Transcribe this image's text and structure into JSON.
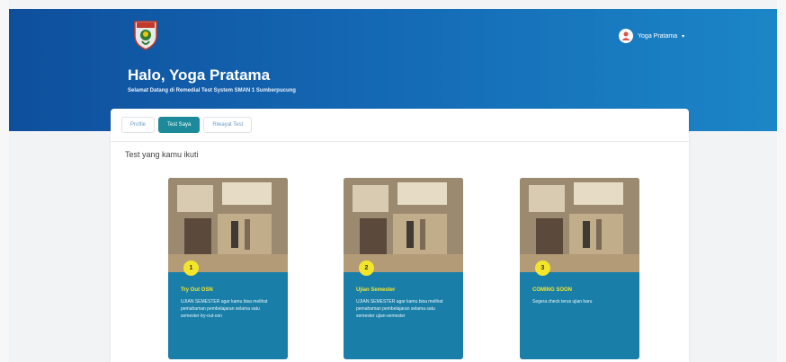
{
  "header": {
    "greeting": "Halo, Yoga Pratama",
    "subtitle": "Selamat Datang di Remedial Test System SMAN 1 Sumberpucung",
    "user_name": "Yoga Pratama",
    "caret": "▾"
  },
  "tabs": [
    {
      "label": "Profile",
      "active": false
    },
    {
      "label": "Test Saya",
      "active": true
    },
    {
      "label": "Riwayat Test",
      "active": false
    }
  ],
  "section": {
    "title": "Test yang kamu ikuti"
  },
  "tests": [
    {
      "number": "1",
      "title": "Try Out OSN",
      "description": "UJIAN SEMESTER agar kamu bisa melihat pemahaman pembelajaran selama satu semester try-out-osn"
    },
    {
      "number": "2",
      "title": "Ujian Semester",
      "description": "UJIAN SEMESTER agar kamu bisa melihat pemahaman pembelajaran selama satu semester ujian-semester"
    },
    {
      "number": "3",
      "title": "COMING SOON",
      "description": "Segera check terus ujian baru"
    }
  ],
  "colors": {
    "hero_start": "#0e4f9c",
    "hero_end": "#1b86c7",
    "tab_active": "#1c8a9a",
    "card_bg": "#1a7fa8",
    "accent_yellow": "#f3e62a"
  }
}
